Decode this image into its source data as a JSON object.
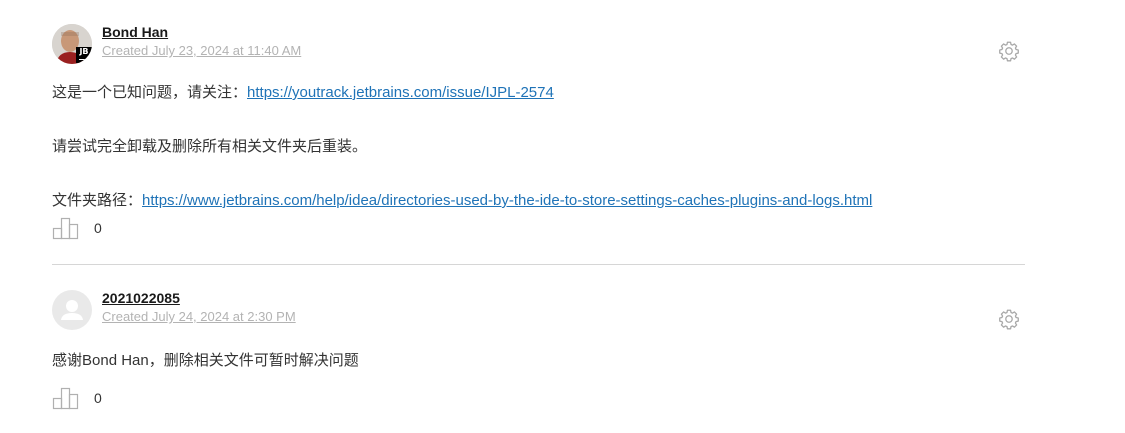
{
  "comments": [
    {
      "author": "Bond Han",
      "created": "Created July 23, 2024 at 11:40 AM",
      "avatar_badge": "JB",
      "body": {
        "line1_prefix": "这是一个已知问题，请关注：",
        "line1_link": "https://youtrack.jetbrains.com/issue/IJPL-2574",
        "line2": "请尝试完全卸载及删除所有相关文件夹后重装。",
        "line3_prefix": "文件夹路径：",
        "line3_link": "https://www.jetbrains.com/help/idea/directories-used-by-the-ide-to-store-settings-caches-plugins-and-logs.html"
      },
      "votes": "0"
    },
    {
      "author": "2021022085",
      "created": "Created July 24, 2024 at 2:30 PM",
      "body": {
        "line1": "感谢Bond Han，删除相关文件可暂时解决问题"
      },
      "votes": "0"
    }
  ],
  "icons": {
    "gear": "gear-icon",
    "vote": "vote-bars-icon",
    "default_avatar": "user-silhouette-icon"
  },
  "colors": {
    "link": "#1f73b7",
    "meta": "#b3b3b3",
    "divider": "#d6d6d6"
  }
}
